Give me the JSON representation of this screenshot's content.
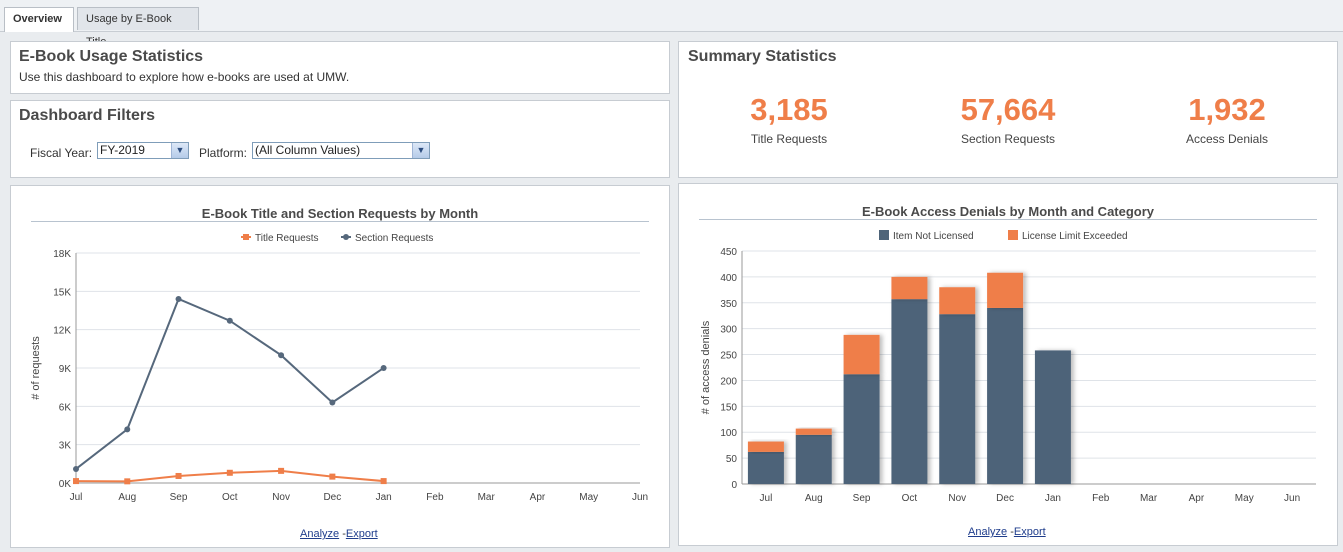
{
  "tabs": [
    {
      "label": "Overview",
      "active": true
    },
    {
      "label": "Usage by E-Book Title",
      "active": false
    }
  ],
  "intro": {
    "title": "E-Book Usage Statistics",
    "subtitle": "Use this dashboard to explore how e-books are used at UMW."
  },
  "filters": {
    "title": "Dashboard Filters",
    "fiscal_year_label": "Fiscal Year:",
    "fiscal_year_value": "FY-2019",
    "platform_label": "Platform:",
    "platform_value": "(All Column Values)"
  },
  "summary": {
    "title": "Summary Statistics",
    "stats": [
      {
        "value": "3,185",
        "label": "Title Requests"
      },
      {
        "value": "57,664",
        "label": "Section Requests"
      },
      {
        "value": "1,932",
        "label": "Access Denials"
      }
    ]
  },
  "links": {
    "analyze": "Analyze",
    "export": "Export",
    "sep": "-"
  },
  "chart_data": [
    {
      "type": "line",
      "title": "E-Book Title and Section Requests by Month",
      "ylabel": "# of requests",
      "categories": [
        "Jul",
        "Aug",
        "Sep",
        "Oct",
        "Nov",
        "Dec",
        "Jan",
        "Feb",
        "Mar",
        "Apr",
        "May",
        "Jun"
      ],
      "ylim": [
        0,
        18000
      ],
      "yticks": [
        "0K",
        "3K",
        "6K",
        "9K",
        "12K",
        "15K",
        "18K"
      ],
      "legend": "top",
      "series": [
        {
          "name": "Title Requests",
          "color": "#ef7e49",
          "values": [
            150,
            130,
            550,
            800,
            950,
            500,
            150
          ]
        },
        {
          "name": "Section Requests",
          "color": "#56687c",
          "values": [
            1100,
            4200,
            14400,
            12700,
            10000,
            6300,
            9000
          ]
        }
      ]
    },
    {
      "type": "bar",
      "title": "E-Book Access Denials by Month and Category",
      "ylabel": "# of access denials",
      "categories": [
        "Jul",
        "Aug",
        "Sep",
        "Oct",
        "Nov",
        "Dec",
        "Jan",
        "Feb",
        "Mar",
        "Apr",
        "May",
        "Jun"
      ],
      "ylim": [
        0,
        450
      ],
      "yticks": [
        "0",
        "50",
        "100",
        "150",
        "200",
        "250",
        "300",
        "350",
        "400",
        "450"
      ],
      "stacked": true,
      "legend": "top",
      "series": [
        {
          "name": "Item Not Licensed",
          "color": "#4e6479",
          "values": [
            62,
            95,
            212,
            357,
            328,
            340,
            258
          ]
        },
        {
          "name": "License Limit Exceeded",
          "color": "#ef7e49",
          "values": [
            20,
            12,
            76,
            43,
            52,
            68,
            0
          ]
        }
      ]
    }
  ]
}
